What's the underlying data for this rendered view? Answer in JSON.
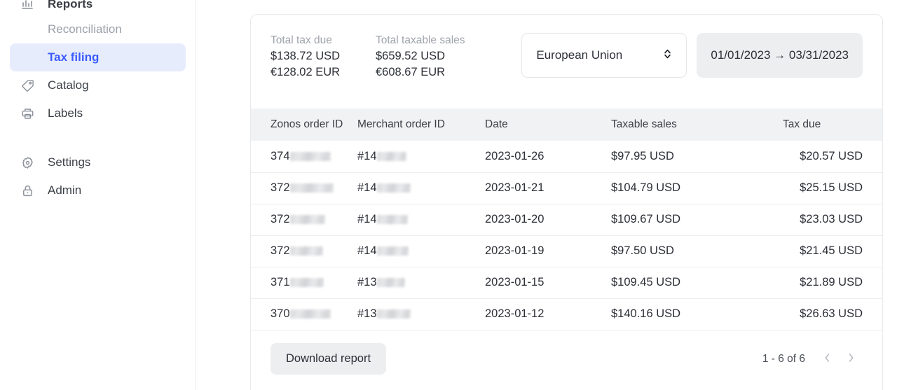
{
  "sidebar": {
    "items": [
      {
        "label": "Reports",
        "icon": "bar-chart-icon",
        "state": "partial-top",
        "name": "reports"
      },
      {
        "label": "Reconciliation",
        "icon": "none",
        "state": "sub",
        "name": "reconciliation"
      },
      {
        "label": "Tax filing",
        "icon": "none",
        "state": "active-sub",
        "name": "tax-filing"
      },
      {
        "label": "Catalog",
        "icon": "tag-icon",
        "state": "normal",
        "name": "catalog"
      },
      {
        "label": "Labels",
        "icon": "printer-icon",
        "state": "normal",
        "name": "labels"
      },
      {
        "label": "Settings",
        "icon": "gear-icon",
        "state": "normal",
        "name": "settings"
      },
      {
        "label": "Admin",
        "icon": "lock-icon",
        "state": "normal",
        "name": "admin"
      }
    ],
    "active_bg": "#e7ecfd",
    "active_fg": "#3b5bfd"
  },
  "summary": {
    "stats": [
      {
        "label": "Total tax due",
        "usd": "$138.72 USD",
        "eur": "€128.02 EUR"
      },
      {
        "label": "Total taxable sales",
        "usd": "$659.52 USD",
        "eur": "€608.67 EUR"
      }
    ],
    "region_select": {
      "value": "European Union",
      "icon": "chevron-up-down-icon"
    },
    "date_range": {
      "start": "01/01/2023",
      "arrow": "→",
      "end": "03/31/2023",
      "display": "01/01/2023 → 03/31/2023"
    }
  },
  "table": {
    "columns": [
      {
        "label": "Zonos order ID",
        "align": "left"
      },
      {
        "label": "Merchant order ID",
        "align": "left"
      },
      {
        "label": "Date",
        "align": "left"
      },
      {
        "label": "Taxable sales",
        "align": "left"
      },
      {
        "label": "Tax due",
        "align": "right"
      }
    ],
    "rows": [
      {
        "zonos_prefix": "374",
        "zonos_redacted_w": 58,
        "merchant_prefix": "#14",
        "merchant_redacted_w": 42,
        "date": "2023-01-26",
        "taxable_sales": "$97.95 USD",
        "tax_due": "$20.57 USD"
      },
      {
        "zonos_prefix": "372",
        "zonos_redacted_w": 62,
        "merchant_prefix": "#14",
        "merchant_redacted_w": 48,
        "date": "2023-01-21",
        "taxable_sales": "$104.79 USD",
        "tax_due": "$25.15 USD"
      },
      {
        "zonos_prefix": "372",
        "zonos_redacted_w": 50,
        "merchant_prefix": "#14",
        "merchant_redacted_w": 44,
        "date": "2023-01-20",
        "taxable_sales": "$109.67 USD",
        "tax_due": "$23.03 USD"
      },
      {
        "zonos_prefix": "372",
        "zonos_redacted_w": 47,
        "merchant_prefix": "#14",
        "merchant_redacted_w": 45,
        "date": "2023-01-19",
        "taxable_sales": "$97.50 USD",
        "tax_due": "$21.45 USD"
      },
      {
        "zonos_prefix": "371",
        "zonos_redacted_w": 48,
        "merchant_prefix": "#13",
        "merchant_redacted_w": 40,
        "date": "2023-01-15",
        "taxable_sales": "$109.45 USD",
        "tax_due": "$21.89 USD"
      },
      {
        "zonos_prefix": "370",
        "zonos_redacted_w": 58,
        "merchant_prefix": "#13",
        "merchant_redacted_w": 48,
        "date": "2023-01-12",
        "taxable_sales": "$140.16 USD",
        "tax_due": "$26.63 USD"
      }
    ]
  },
  "footer": {
    "download_label": "Download report",
    "pagination_text": "1 - 6 of 6",
    "prev_icon": "chevron-left-icon",
    "next_icon": "chevron-right-icon"
  }
}
